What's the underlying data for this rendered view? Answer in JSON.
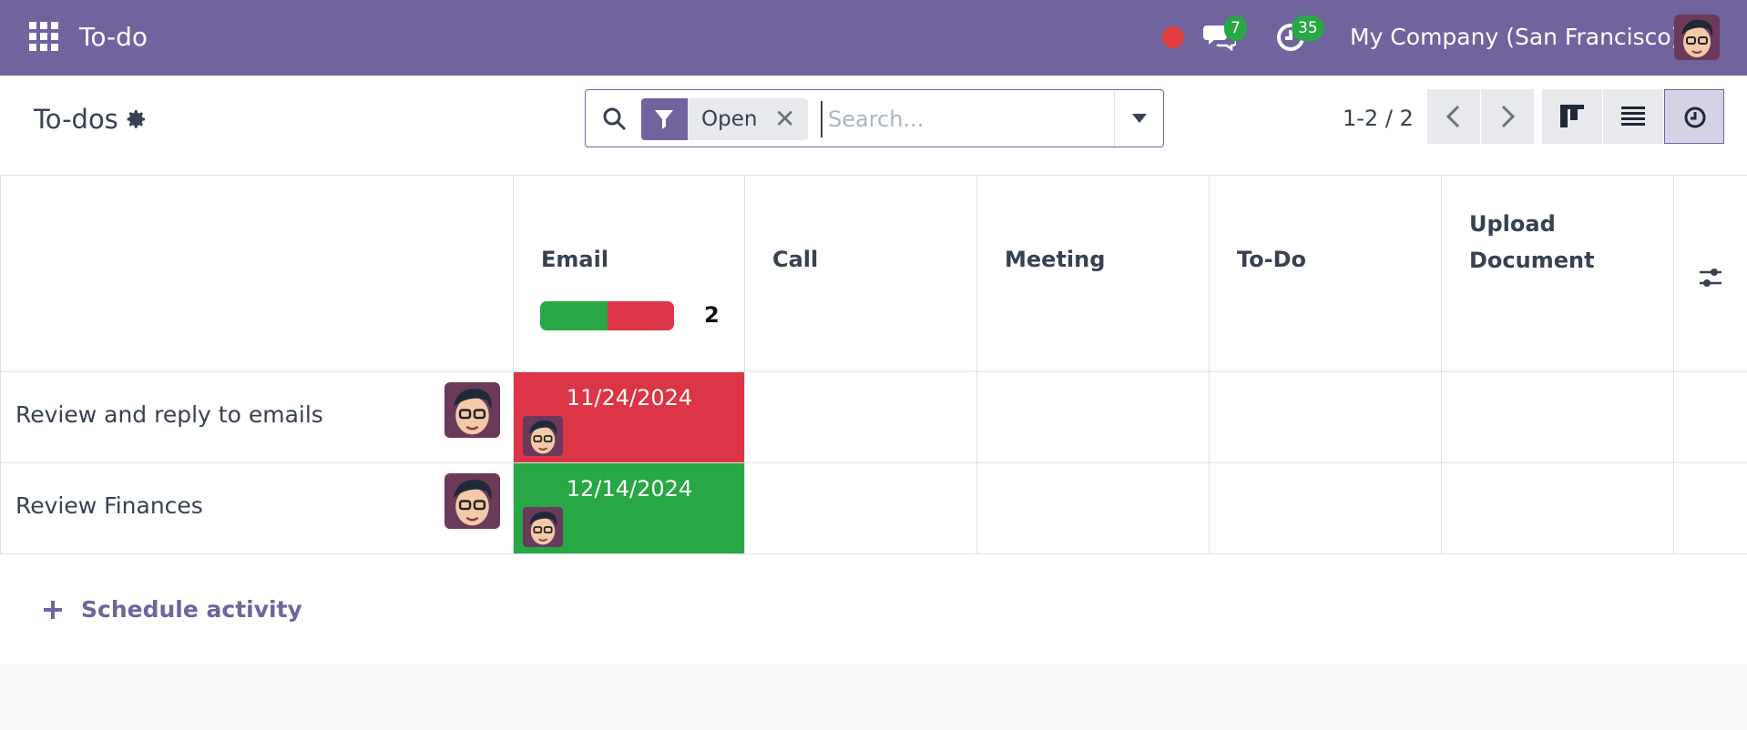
{
  "topbar": {
    "app_title": "To-do",
    "messages_count": "7",
    "activities_count": "35",
    "company": "My Company (San Francisco)"
  },
  "control": {
    "breadcrumb": "To-dos",
    "search": {
      "facet_label": "Open",
      "placeholder": "Search..."
    },
    "pager": "1-2 / 2"
  },
  "grid": {
    "columns": [
      "Email",
      "Call",
      "Meeting",
      "To-Do",
      "Upload Document"
    ],
    "email_summary": {
      "count": "2",
      "progress": {
        "done_fraction": 0.5,
        "overdue_fraction": 0.5
      }
    },
    "rows": [
      {
        "label": "Review and reply to emails",
        "email_date": "11/24/2024",
        "status": "overdue",
        "color": "#dc3545"
      },
      {
        "label": "Review Finances",
        "email_date": "12/14/2024",
        "status": "planned",
        "color": "#28a745"
      }
    ]
  },
  "footer": {
    "schedule_label": "Schedule activity"
  },
  "colors": {
    "brand": "#71639e",
    "success": "#28a745",
    "danger": "#dc3545"
  }
}
